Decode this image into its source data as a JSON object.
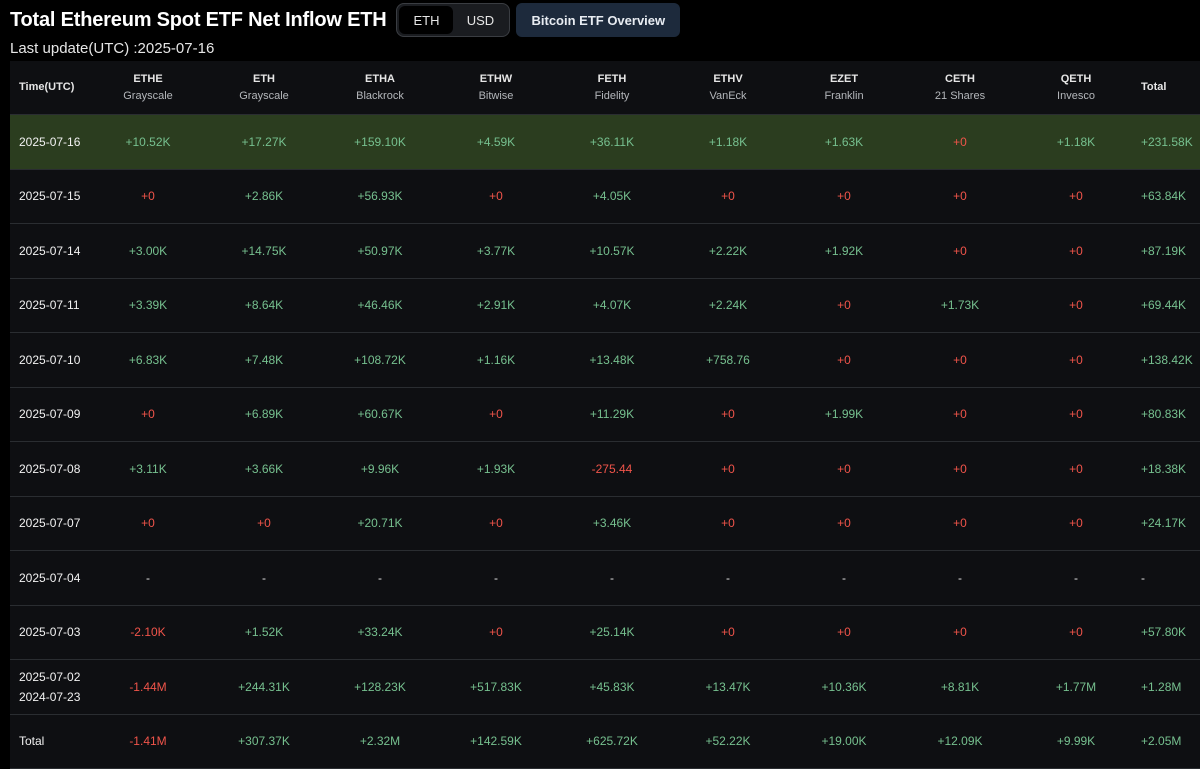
{
  "header": {
    "title": "Total Ethereum Spot ETF Net Inflow ETH",
    "toggle": {
      "eth_label": "ETH",
      "usd_label": "USD",
      "active": "ETH"
    },
    "overview_button": "Bitcoin ETF Overview",
    "last_update": "Last update(UTC) :2025-07-16"
  },
  "colors": {
    "positive": "#76c08f",
    "negative": "#f0544a",
    "highlight_row": "#2b3d1f"
  },
  "table": {
    "columns": [
      {
        "name": "Time(UTC)",
        "sub": ""
      },
      {
        "name": "ETHE",
        "sub": "Grayscale"
      },
      {
        "name": "ETH",
        "sub": "Grayscale"
      },
      {
        "name": "ETHA",
        "sub": "Blackrock"
      },
      {
        "name": "ETHW",
        "sub": "Bitwise"
      },
      {
        "name": "FETH",
        "sub": "Fidelity"
      },
      {
        "name": "ETHV",
        "sub": "VanEck"
      },
      {
        "name": "EZET",
        "sub": "Franklin"
      },
      {
        "name": "CETH",
        "sub": "21 Shares"
      },
      {
        "name": "QETH",
        "sub": "Invesco"
      },
      {
        "name": "Total",
        "sub": ""
      }
    ],
    "rows": [
      {
        "date": [
          "2025-07-16"
        ],
        "highlight": true,
        "values": [
          "+10.52K",
          "+17.27K",
          "+159.10K",
          "+4.59K",
          "+36.11K",
          "+1.18K",
          "+1.63K",
          "+0",
          "+1.18K",
          "+231.58K"
        ]
      },
      {
        "date": [
          "2025-07-15"
        ],
        "values": [
          "+0",
          "+2.86K",
          "+56.93K",
          "+0",
          "+4.05K",
          "+0",
          "+0",
          "+0",
          "+0",
          "+63.84K"
        ]
      },
      {
        "date": [
          "2025-07-14"
        ],
        "values": [
          "+3.00K",
          "+14.75K",
          "+50.97K",
          "+3.77K",
          "+10.57K",
          "+2.22K",
          "+1.92K",
          "+0",
          "+0",
          "+87.19K"
        ]
      },
      {
        "date": [
          "2025-07-11"
        ],
        "values": [
          "+3.39K",
          "+8.64K",
          "+46.46K",
          "+2.91K",
          "+4.07K",
          "+2.24K",
          "+0",
          "+1.73K",
          "+0",
          "+69.44K"
        ]
      },
      {
        "date": [
          "2025-07-10"
        ],
        "values": [
          "+6.83K",
          "+7.48K",
          "+108.72K",
          "+1.16K",
          "+13.48K",
          "+758.76",
          "+0",
          "+0",
          "+0",
          "+138.42K"
        ]
      },
      {
        "date": [
          "2025-07-09"
        ],
        "values": [
          "+0",
          "+6.89K",
          "+60.67K",
          "+0",
          "+11.29K",
          "+0",
          "+1.99K",
          "+0",
          "+0",
          "+80.83K"
        ]
      },
      {
        "date": [
          "2025-07-08"
        ],
        "values": [
          "+3.11K",
          "+3.66K",
          "+9.96K",
          "+1.93K",
          "-275.44",
          "+0",
          "+0",
          "+0",
          "+0",
          "+18.38K"
        ]
      },
      {
        "date": [
          "2025-07-07"
        ],
        "values": [
          "+0",
          "+0",
          "+20.71K",
          "+0",
          "+3.46K",
          "+0",
          "+0",
          "+0",
          "+0",
          "+24.17K"
        ]
      },
      {
        "date": [
          "2025-07-04"
        ],
        "values": [
          "-",
          "-",
          "-",
          "-",
          "-",
          "-",
          "-",
          "-",
          "-",
          "-"
        ]
      },
      {
        "date": [
          "2025-07-03"
        ],
        "values": [
          "-2.10K",
          "+1.52K",
          "+33.24K",
          "+0",
          "+25.14K",
          "+0",
          "+0",
          "+0",
          "+0",
          "+57.80K"
        ]
      },
      {
        "date": [
          "2025-07-02",
          "2024-07-23"
        ],
        "values": [
          "-1.44M",
          "+244.31K",
          "+128.23K",
          "+517.83K",
          "+45.83K",
          "+13.47K",
          "+10.36K",
          "+8.81K",
          "+1.77M",
          "+1.28M"
        ]
      },
      {
        "date": [
          "Total"
        ],
        "values": [
          "-1.41M",
          "+307.37K",
          "+2.32M",
          "+142.59K",
          "+625.72K",
          "+52.22K",
          "+19.00K",
          "+12.09K",
          "+9.99K",
          "+2.05M"
        ]
      }
    ]
  }
}
